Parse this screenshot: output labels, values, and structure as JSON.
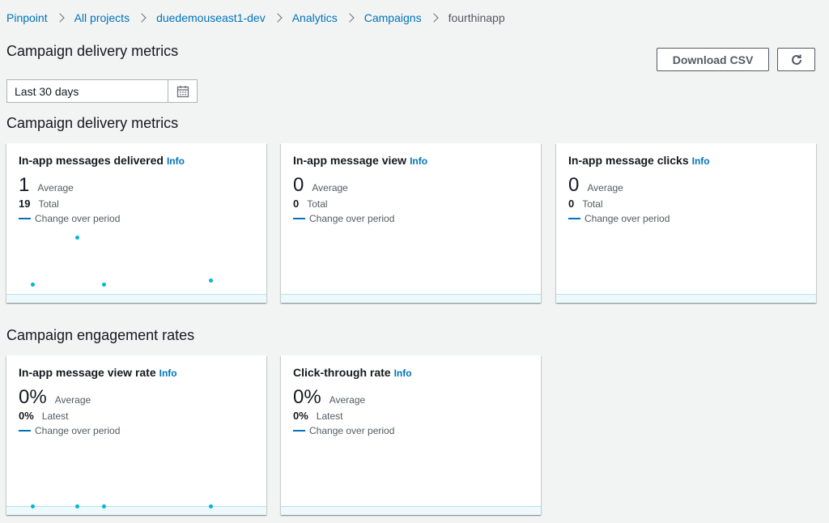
{
  "breadcrumb": {
    "items": [
      "Pinpoint",
      "All projects",
      "duedemouseast1-dev",
      "Analytics",
      "Campaigns"
    ],
    "current": "fourthinapp"
  },
  "header": {
    "title": "Campaign delivery metrics",
    "download_label": "Download CSV",
    "refresh_icon": "refresh-icon"
  },
  "date_range": {
    "value": "Last 30 days",
    "icon": "calendar-icon"
  },
  "delivery_section": {
    "title": "Campaign delivery metrics",
    "cards": [
      {
        "title": "In-app messages delivered",
        "info": "Info",
        "value": "1",
        "value_label": "Average",
        "sub_value": "19",
        "sub_label": "Total",
        "legend": "Change over period",
        "points": [
          0.1,
          0.9,
          0.1,
          0.2
        ]
      },
      {
        "title": "In-app message view",
        "info": "Info",
        "value": "0",
        "value_label": "Average",
        "sub_value": "0",
        "sub_label": "Total",
        "legend": "Change over period",
        "points": []
      },
      {
        "title": "In-app message clicks",
        "info": "Info",
        "value": "0",
        "value_label": "Average",
        "sub_value": "0",
        "sub_label": "Total",
        "legend": "Change over period",
        "points": []
      }
    ]
  },
  "engagement_section": {
    "title": "Campaign engagement rates",
    "cards": [
      {
        "title": "In-app message view rate",
        "info": "Info",
        "value": "0%",
        "value_label": "Average",
        "sub_value": "0%",
        "sub_label": "Latest",
        "legend": "Change over period",
        "points": [
          0,
          0,
          0,
          0
        ]
      },
      {
        "title": "Click-through rate",
        "info": "Info",
        "value": "0%",
        "value_label": "Average",
        "sub_value": "0%",
        "sub_label": "Latest",
        "legend": "Change over period",
        "points": []
      }
    ]
  },
  "colors": {
    "link": "#0073bb",
    "dot": "#00b7d7",
    "background": "#f2f3f3"
  }
}
